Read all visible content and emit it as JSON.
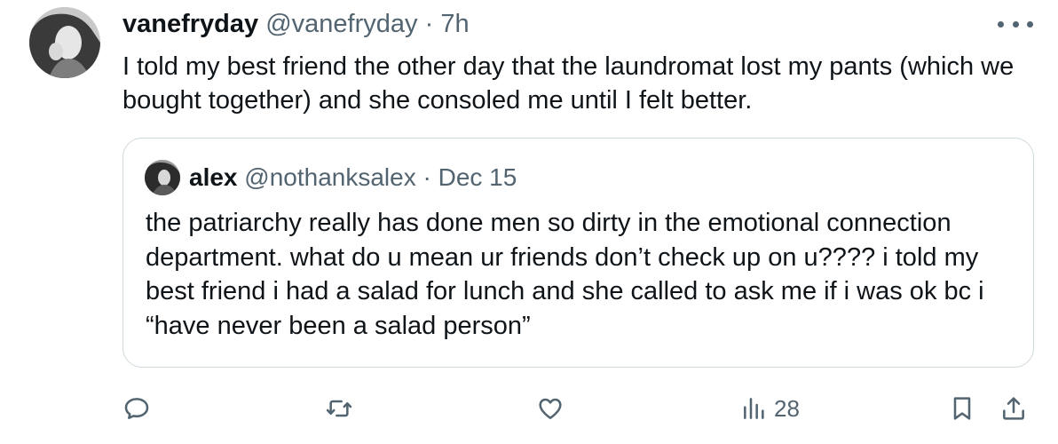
{
  "tweet": {
    "display_name": "vanefryday",
    "handle": "@vanefryday",
    "separator": "·",
    "time": "7h",
    "text": "I told my best friend the other day that the laundromat lost my pants (which we bought together) and she consoled me until I felt better."
  },
  "quote": {
    "display_name": "alex",
    "handle": "@nothanksalex",
    "separator": "·",
    "time": "Dec 15",
    "text": "the patriarchy really has done men so dirty in the emotional connection department. what do u mean ur friends don’t check up on u???? i told my best friend i had a salad for lunch and she called to ask me if i was ok bc i “have never been a salad person”"
  },
  "actions": {
    "reply_icon": "reply-icon",
    "retweet_icon": "retweet-icon",
    "like_icon": "like-icon",
    "views_icon": "views-icon",
    "views_count": "28",
    "bookmark_icon": "bookmark-icon",
    "share_icon": "share-icon"
  },
  "colors": {
    "text": "#0f1419",
    "secondary": "#536471",
    "border": "#cfd9de"
  }
}
